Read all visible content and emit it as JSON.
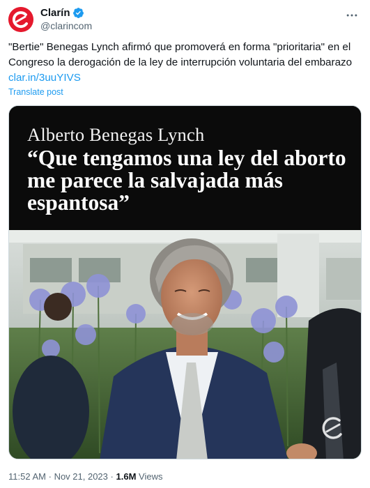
{
  "account": {
    "name": "Clarín",
    "handle": "@clarincom",
    "avatar_icon": "clarin-logo-icon",
    "verified_icon": "verified-badge-icon",
    "more_icon": "more-options-icon",
    "brand_color": "#e5192d",
    "verified_color": "#1d9bf0"
  },
  "tweet": {
    "text": "\"Bertie\" Benegas Lynch afirmó que promoverá en forma \"prioritaria\" en el Congreso la derogación de la ley de interrupción voluntaria del embarazo",
    "link": "clar.in/3uuYIVS",
    "translate_label": "Translate post"
  },
  "media": {
    "name": "Alberto Benegas Lynch",
    "quote": "“Que tengamos una ley del aborto me parece la salvajada más espantosa”",
    "watermark_icon": "clarin-watermark-icon"
  },
  "meta": {
    "time": "11:52 AM",
    "separator": "·",
    "date": "Nov 21, 2023",
    "views_count": "1.6M",
    "views_label": "Views"
  }
}
